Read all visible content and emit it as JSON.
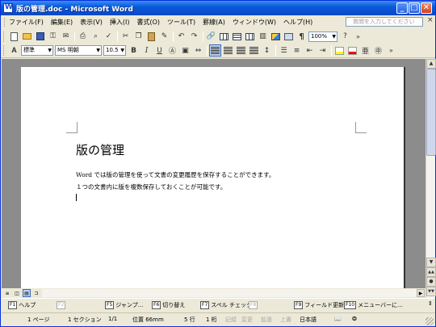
{
  "window": {
    "title": "版の管理.doc - Microsoft Word",
    "min_label": "_",
    "max_label": "□",
    "close_label": "✕"
  },
  "menubar": {
    "items": [
      "ファイル(F)",
      "編集(E)",
      "表示(V)",
      "挿入(I)",
      "書式(O)",
      "ツール(T)",
      "罫線(A)",
      "ウィンドウ(W)",
      "ヘルプ(H)"
    ],
    "help_placeholder": "質問を入力してください",
    "close_label": "×"
  },
  "toolbar_standard": {
    "zoom": "100%",
    "icons": [
      "new-icon",
      "open-icon",
      "save-icon",
      "permission-icon",
      "email-icon",
      "print-icon",
      "print-preview-icon",
      "spelling-icon",
      "cut-icon",
      "copy-icon",
      "paste-icon",
      "format-painter-icon",
      "undo-icon",
      "redo-icon",
      "hyperlink-icon",
      "tables-borders-icon",
      "insert-table-icon",
      "insert-excel-icon",
      "columns-icon",
      "drawing-icon",
      "document-map-icon",
      "show-formatting-icon",
      "zoom-icon",
      "help-icon",
      "options-icon"
    ]
  },
  "toolbar_format": {
    "style": "標準",
    "font": "MS 明朝",
    "size": "10.5",
    "bold": "B",
    "italic": "I",
    "underline": "U",
    "colors": {
      "highlight": "#ffff00",
      "font": "#ff0000"
    }
  },
  "document": {
    "heading": "版の管理",
    "lines": [
      "Word では版の管理を使って文書の変更履歴を保存することができます。",
      "１つの文書内に版を複数保存しておくことが可能です。"
    ]
  },
  "fkeys": [
    {
      "key": "F1",
      "label": "ヘルプ",
      "enabled": true
    },
    {
      "key": "F2",
      "label": "",
      "enabled": false
    },
    {
      "key": "F5",
      "label": "ジャンプ...",
      "enabled": true
    },
    {
      "key": "F6",
      "label": "切り替え",
      "enabled": true
    },
    {
      "key": "F7",
      "label": "スペル チェック...",
      "enabled": true
    },
    {
      "key": "F8",
      "label": "",
      "enabled": false
    },
    {
      "key": "F9",
      "label": "フィールド更新",
      "enabled": true
    },
    {
      "key": "F10",
      "label": "メニューバーに...",
      "enabled": true
    }
  ],
  "statusbar": {
    "page": "1 ページ",
    "section": "1 セクション",
    "page_of": "1/1",
    "position": "位置 66mm",
    "line": "5 行",
    "column": "1 桁",
    "rec": "記録",
    "trk": "変更",
    "ext": "拡張",
    "ovr": "上書",
    "language": "日本語"
  },
  "colors": {
    "titlebar": "#0a5ad8",
    "chrome": "#ece9d8",
    "workspace": "#8c8c8c"
  }
}
